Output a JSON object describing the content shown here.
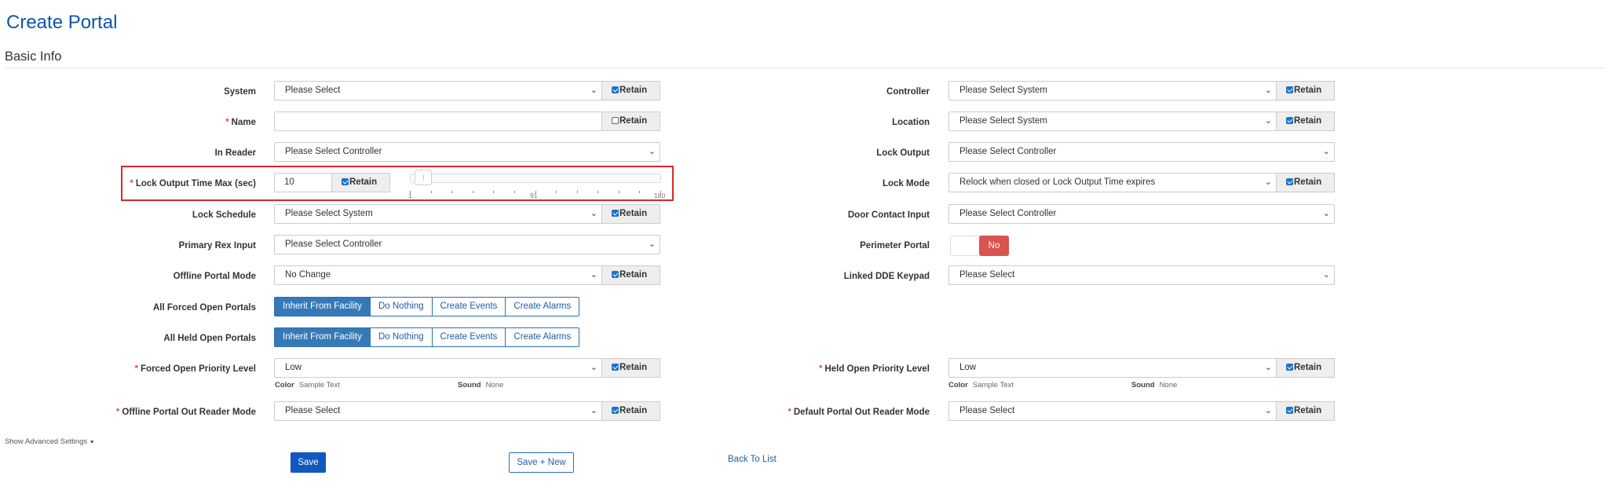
{
  "page": {
    "title": "Create Portal",
    "section": "Basic Info"
  },
  "retain_label": "Retain",
  "left": {
    "system": {
      "label": "System",
      "value": "Please Select",
      "retain": true
    },
    "name": {
      "label": "Name",
      "required": true,
      "value": "",
      "retain": false
    },
    "in_reader": {
      "label": "In Reader",
      "value": "Please Select Controller"
    },
    "lock_output_time_max": {
      "label": "Lock Output Time Max (sec)",
      "required": true,
      "value": "10",
      "retain": true,
      "slider": {
        "min": "1",
        "mid": "91",
        "max": "180",
        "value": 10
      }
    },
    "lock_schedule": {
      "label": "Lock Schedule",
      "value": "Please Select System",
      "retain": true
    },
    "primary_rex_input": {
      "label": "Primary Rex Input",
      "value": "Please Select Controller"
    },
    "offline_portal_mode": {
      "label": "Offline Portal Mode",
      "value": "No Change",
      "retain": true
    },
    "all_forced_open_portals": {
      "label": "All Forced Open Portals",
      "options": [
        "Inherit From Facility",
        "Do Nothing",
        "Create Events",
        "Create Alarms"
      ],
      "active": 0
    },
    "all_held_open_portals": {
      "label": "All Held Open Portals",
      "options": [
        "Inherit From Facility",
        "Do Nothing",
        "Create Events",
        "Create Alarms"
      ],
      "active": 0
    },
    "forced_open_priority_level": {
      "label": "Forced Open Priority Level",
      "required": true,
      "value": "Low",
      "retain": true,
      "color_label": "Color",
      "color_value": "Sample Text",
      "sound_label": "Sound",
      "sound_value": "None"
    },
    "offline_portal_out_reader_mode": {
      "label": "Offline Portal Out Reader Mode",
      "required": true,
      "value": "Please Select",
      "retain": true
    }
  },
  "right": {
    "controller": {
      "label": "Controller",
      "value": "Please Select System",
      "retain": true
    },
    "location": {
      "label": "Location",
      "value": "Please Select System",
      "retain": true
    },
    "lock_output": {
      "label": "Lock Output",
      "value": "Please Select Controller"
    },
    "lock_mode": {
      "label": "Lock Mode",
      "value": "Relock when closed or Lock Output Time expires",
      "retain": true
    },
    "door_contact_input": {
      "label": "Door Contact Input",
      "value": "Please Select Controller"
    },
    "perimeter_portal": {
      "label": "Perimeter Portal",
      "value": "No"
    },
    "linked_dde_keypad": {
      "label": "Linked DDE Keypad",
      "value": "Please Select"
    },
    "held_open_priority_level": {
      "label": "Held Open Priority Level",
      "required": true,
      "value": "Low",
      "retain": true,
      "color_label": "Color",
      "color_value": "Sample Text",
      "sound_label": "Sound",
      "sound_value": "None"
    },
    "default_portal_out_reader_mode": {
      "label": "Default Portal Out Reader Mode",
      "required": true,
      "value": "Please Select",
      "retain": true
    }
  },
  "footer": {
    "advanced_settings": "Show Advanced Settings",
    "save": "Save",
    "save_new": "Save + New",
    "back_to_list": "Back To List"
  },
  "colors": {
    "primary": "#1157c0",
    "title": "#0b57a8",
    "danger": "#d9534f",
    "highlight": "#d9262c",
    "active_tab": "#357ab7"
  }
}
